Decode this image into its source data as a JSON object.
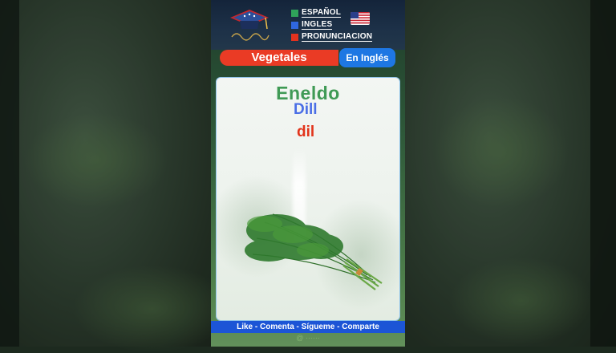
{
  "header": {
    "legend": [
      {
        "label": "ESPAÑOL",
        "color": "#2fa35a"
      },
      {
        "label": "INGLES",
        "color": "#2f67e0"
      },
      {
        "label": "PRONUNCIACION",
        "color": "#e3321e"
      }
    ],
    "flag_icon": "us-flag-icon",
    "logo_icon": "graduation-cap-logo"
  },
  "topic": {
    "title": "Vegetales",
    "badge": "En Inglés"
  },
  "card": {
    "word_spanish": "Eneldo",
    "word_english": "Dill",
    "pronunciation": "dil",
    "image_icon": "dill-herb"
  },
  "footer": {
    "cta": "Like - Comenta - Sígueme - Comparte"
  },
  "colors": {
    "spanish": "#3f9a55",
    "english": "#4a6ee6",
    "pronunciation": "#e2341b",
    "title_bar": "#ea3b25",
    "badge": "#1e77e3",
    "footer": "#1c55d6"
  }
}
